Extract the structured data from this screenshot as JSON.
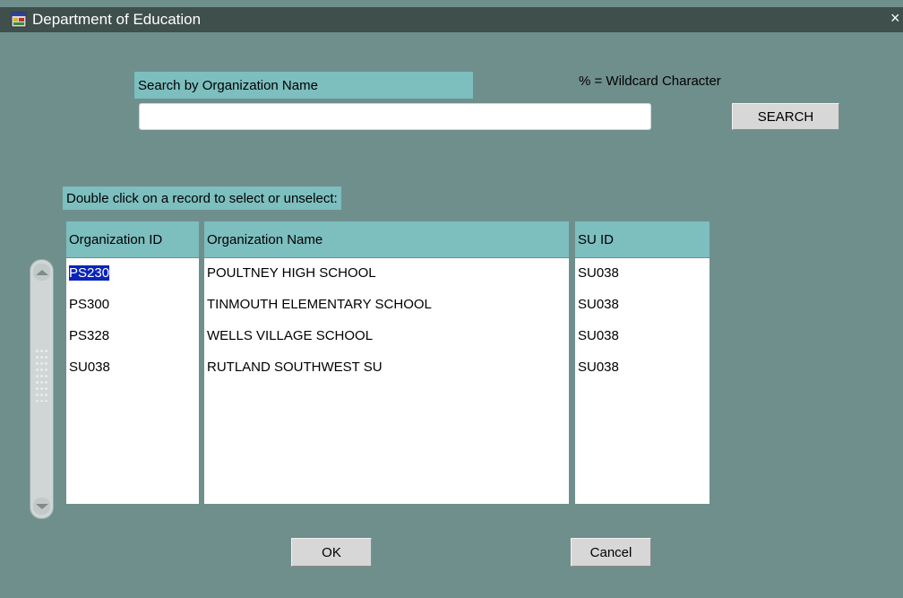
{
  "window": {
    "title": "Department of Education",
    "close_glyph": "×",
    "icon": "app-window-icon"
  },
  "search": {
    "label": "Search by Organization Name",
    "wildcard_note": "% = Wildcard Character",
    "value": "",
    "button_label": "SEARCH"
  },
  "instructions": "Double click on a record to select or unselect:",
  "table": {
    "headers": [
      "Organization ID",
      "Organization Name",
      "SU ID"
    ],
    "rows": [
      {
        "id": "PS230",
        "name": "POULTNEY HIGH SCHOOL",
        "su": "SU038",
        "selected": true
      },
      {
        "id": "PS300",
        "name": "TINMOUTH ELEMENTARY SCHOOL",
        "su": "SU038",
        "selected": false
      },
      {
        "id": "PS328",
        "name": "WELLS VILLAGE SCHOOL",
        "su": "SU038",
        "selected": false
      },
      {
        "id": "SU038",
        "name": "RUTLAND SOUTHWEST SU",
        "su": "SU038",
        "selected": false
      }
    ]
  },
  "buttons": {
    "ok_label": "OK",
    "cancel_label": "Cancel"
  },
  "colors": {
    "background": "#6f8f8d",
    "titlebar": "#3f4f4c",
    "label_bg": "#7dbebf",
    "selection": "#0a24b8"
  }
}
